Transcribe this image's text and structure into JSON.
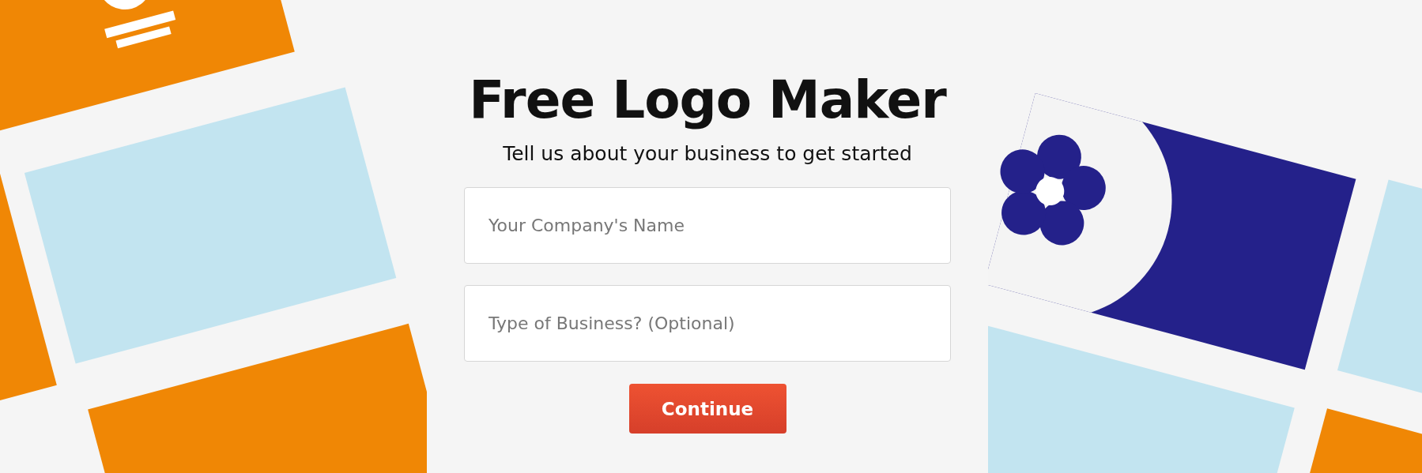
{
  "heading": "Free Logo Maker",
  "subheading": "Tell us about your business to get started",
  "fields": [
    {
      "placeholder": "Your Company's Name"
    },
    {
      "placeholder": "Type of Business? (Optional)"
    }
  ],
  "button": "Continue"
}
